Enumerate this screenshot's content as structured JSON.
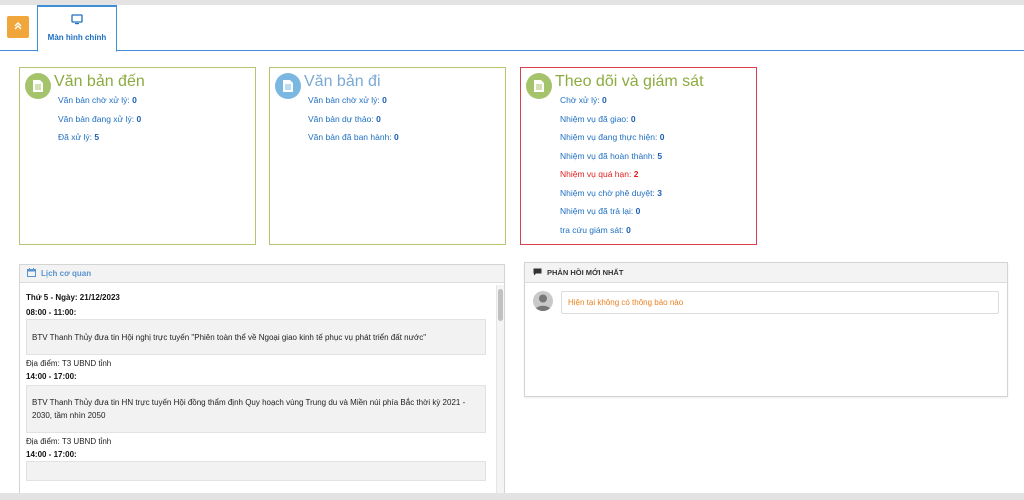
{
  "tabbar": {
    "tab_label": "Màn hình chính"
  },
  "box_incoming": {
    "title": "Văn bản đến",
    "items": [
      {
        "label": "Văn bản chờ xử lý:",
        "count": "0"
      },
      {
        "label": "Văn bản đang xử lý:",
        "count": "0"
      },
      {
        "label": "Đã xử lý:",
        "count": "5"
      }
    ]
  },
  "box_outgoing": {
    "title": "Văn bản đi",
    "items": [
      {
        "label": "Văn bản chờ xử lý:",
        "count": "0"
      },
      {
        "label": "Văn bản dự thảo:",
        "count": "0"
      },
      {
        "label": "Văn bản đã ban hành:",
        "count": "0"
      }
    ]
  },
  "box_monitor": {
    "title": "Theo dõi và giám sát",
    "items": [
      {
        "label": "Chờ xử lý:",
        "count": "0"
      },
      {
        "label": "Nhiệm vụ đã giao:",
        "count": "0"
      },
      {
        "label": "Nhiệm vụ đang thực hiện:",
        "count": "0"
      },
      {
        "label": "Nhiệm vụ đã hoàn thành:",
        "count": "5"
      },
      {
        "label": "Nhiệm vụ quá hạn:",
        "count": "2"
      },
      {
        "label": "Nhiệm vụ chờ phê duyệt:",
        "count": "3"
      },
      {
        "label": "Nhiệm vụ đã trả lại:",
        "count": "0"
      },
      {
        "label": "tra cứu giám sát:",
        "count": "0"
      }
    ]
  },
  "schedule": {
    "title": "Lịch cơ quan",
    "day": "Thứ 5 - Ngày:  21/12/2023",
    "entries": [
      {
        "time": "08:00 - 11:00:",
        "text": "BTV Thanh Thủy đưa tin Hội nghị trực tuyến \"Phiên toàn thể về Ngoại giao kinh tế phục vụ phát triển đất nước\"",
        "location": "Địa điểm: T3 UBND tỉnh"
      },
      {
        "time": "14:00 - 17:00:",
        "text": "BTV Thanh Thủy đưa tin HN trực tuyến Hội đồng thẩm định Quy hoạch vùng Trung du và Miền núi phía Bắc  thời kỳ 2021 - 2030, tầm nhìn 2050",
        "location": "Địa điểm: T3 UBND tỉnh"
      }
    ],
    "next_time": "14:00 - 17:00:"
  },
  "feedback": {
    "title": "PHẢN HỒI MỚI NHẤT",
    "message": "Hiện tại không có thông báo nào"
  },
  "colors": {
    "accent_blue": "#1e6fc1",
    "olive_border": "#b7c56e",
    "red_border": "#d84050",
    "orange": "#f0a63a",
    "overdue_red": "#e01f1f"
  },
  "icons": [
    "double-chevron-up-icon",
    "monitor-icon",
    "document-icon",
    "calendar-icon",
    "comment-icon",
    "user-avatar-icon"
  ]
}
